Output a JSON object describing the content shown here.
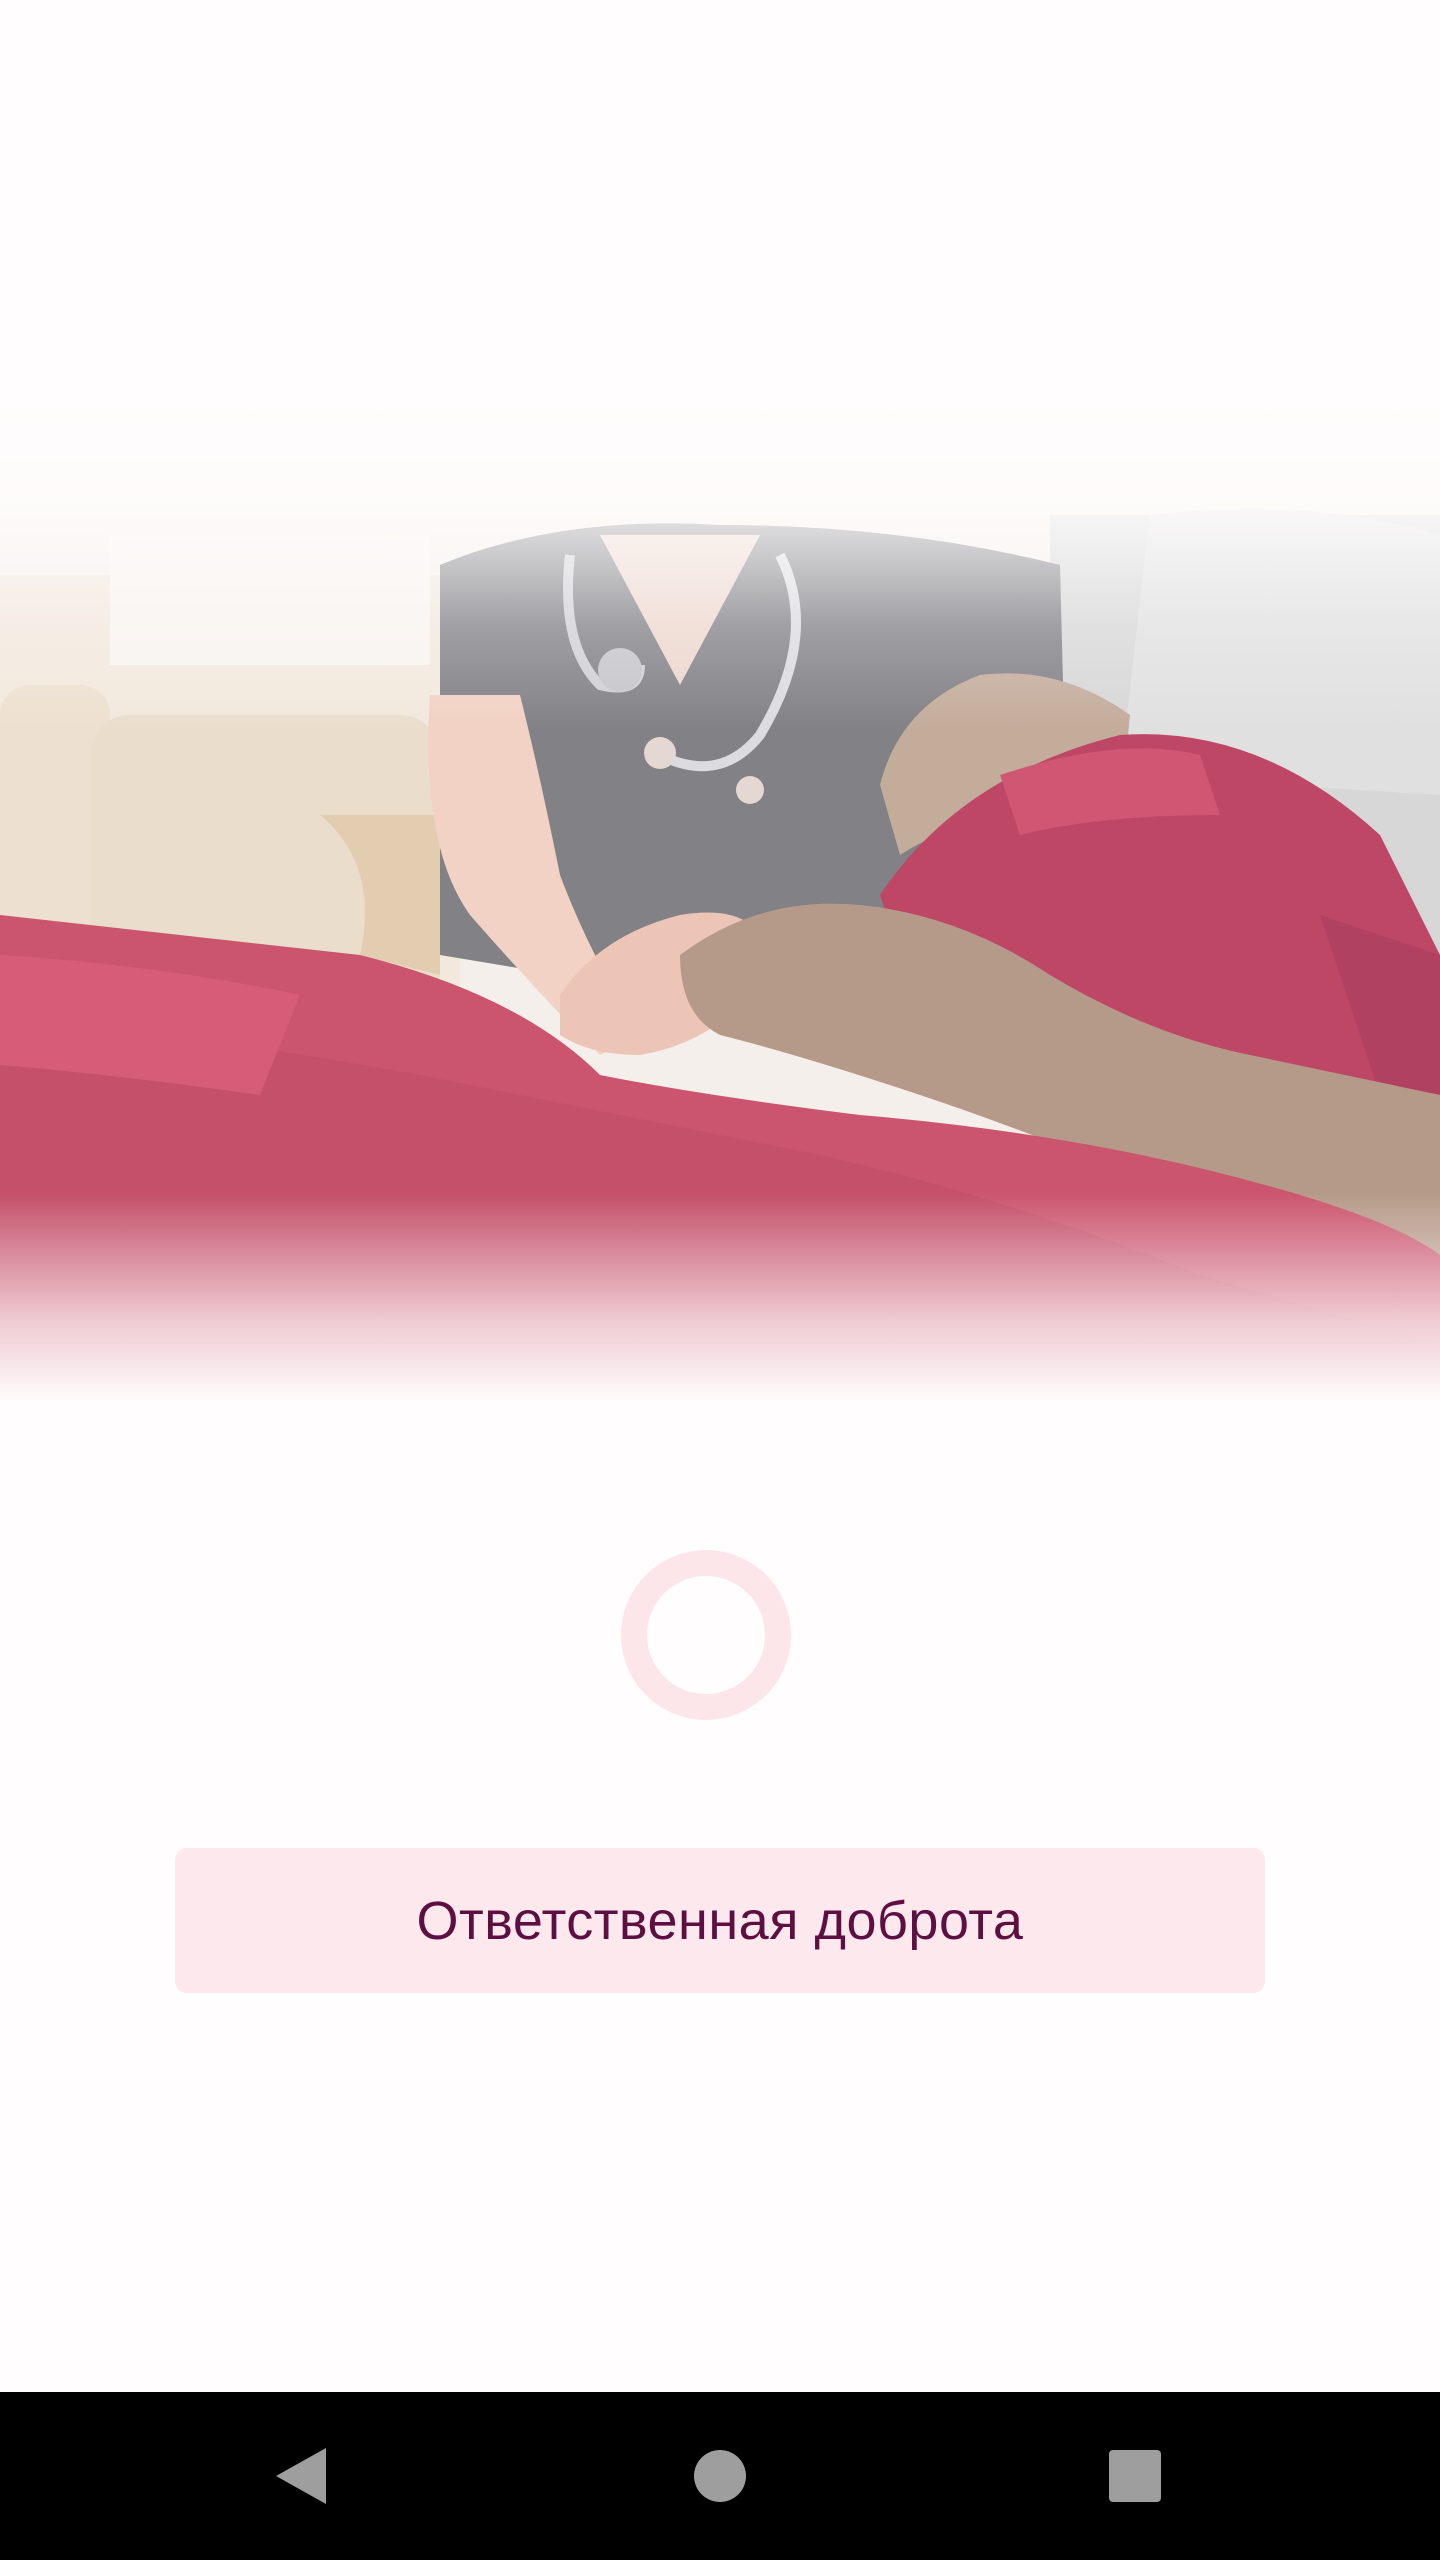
{
  "tagline": {
    "text": "Ответственная доброта"
  },
  "hero": {
    "description_icon": "caregiver-holding-hand-photo"
  },
  "spinner": {
    "icon": "loading-ring"
  },
  "colors": {
    "accent": "#5e0f42",
    "card_bg": "#fde9ed",
    "spinner": "#fde6ea",
    "blanket": "#c0304f",
    "navbar_bg": "#000000",
    "nav_icon": "#9e9e9e"
  },
  "navbar": {
    "back_icon": "back-triangle-icon",
    "home_icon": "home-circle-icon",
    "recents_icon": "recents-square-icon"
  }
}
